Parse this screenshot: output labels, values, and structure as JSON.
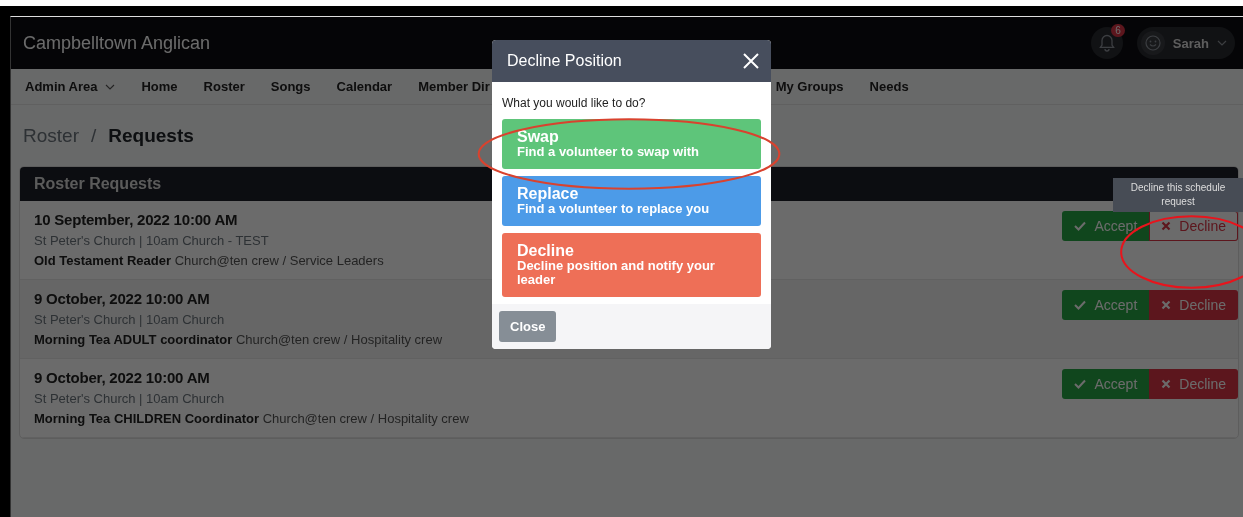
{
  "app": {
    "title": "Campbelltown Anglican"
  },
  "notifications": {
    "count": "6"
  },
  "user": {
    "name": "Sarah"
  },
  "nav": [
    {
      "label": "Admin Area",
      "dropdown": true
    },
    {
      "label": "Home",
      "dropdown": false
    },
    {
      "label": "Roster",
      "dropdown": false
    },
    {
      "label": "Songs",
      "dropdown": false
    },
    {
      "label": "Calendar",
      "dropdown": false
    },
    {
      "label": "Member Dir",
      "dropdown": false
    },
    {
      "label": "My Groups",
      "dropdown": false
    },
    {
      "label": "Needs",
      "dropdown": false
    }
  ],
  "breadcrumb": [
    {
      "label": "Roster",
      "current": false
    },
    {
      "label": "Requests",
      "current": true
    }
  ],
  "breadcrumb_separator": "/",
  "card": {
    "title": "Roster Requests",
    "rows": [
      {
        "date": "10 September, 2022 10:00 AM",
        "location": "St Peter's Church | 10am Church - TEST",
        "role": "**Old Testament Reader** Church@ten crew / Service Leaders",
        "accept": "Accept",
        "decline": "Decline",
        "decline_focused": true
      },
      {
        "date": "9 October, 2022 10:00 AM",
        "location": "St Peter's Church | 10am Church",
        "role": "**Morning Tea ADULT coordinator** Church@ten crew / Hospitality crew",
        "accept": "Accept",
        "decline": "Decline",
        "decline_focused": false
      },
      {
        "date": "9 October, 2022 10:00 AM",
        "location": "St Peter's Church | 10am Church",
        "role": "**Morning Tea CHILDREN Coordinator** Church@ten crew / Hospitality crew",
        "accept": "Accept",
        "decline": "Decline",
        "decline_focused": false
      }
    ]
  },
  "tooltip": {
    "text": "Decline this schedule request"
  },
  "modal": {
    "title": "Decline Position",
    "prompt": "What you would like to do?",
    "options": [
      {
        "kind": "swap",
        "title": "Swap",
        "subtitle": "Find a volunteer to swap with"
      },
      {
        "kind": "replace",
        "title": "Replace",
        "subtitle": "Find a volunteer to replace you"
      },
      {
        "kind": "decline",
        "title": "Decline",
        "subtitle": "Decline position and notify your leader"
      }
    ],
    "close": "Close"
  },
  "annotations": [
    {
      "kind": "ellipse"
    },
    {
      "kind": "ellipse"
    }
  ]
}
